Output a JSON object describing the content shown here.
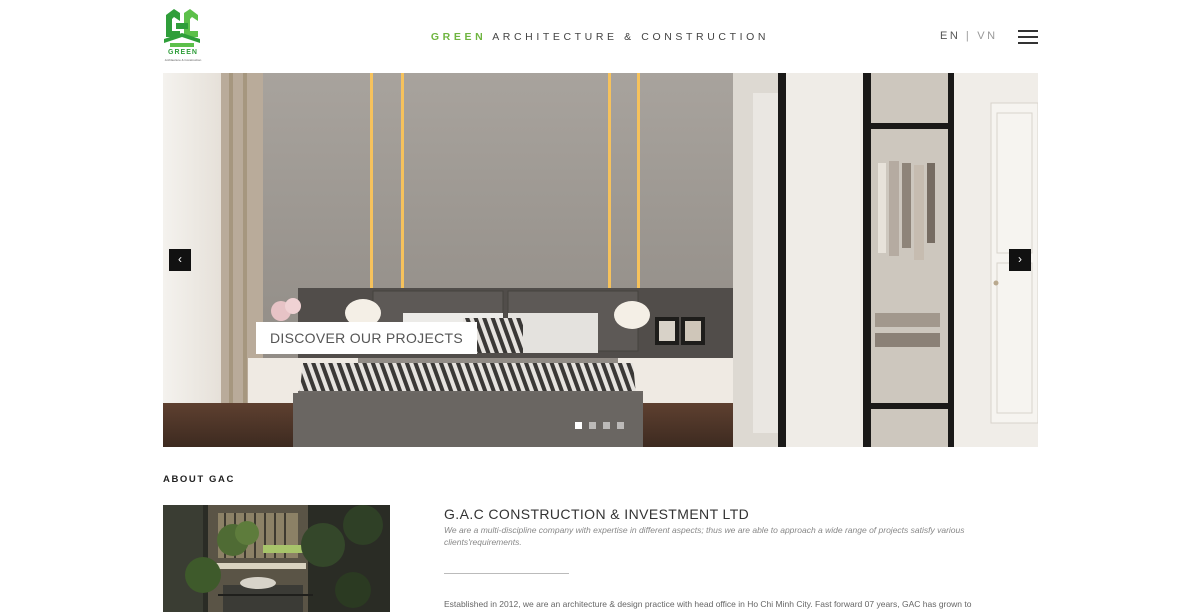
{
  "header": {
    "logo": {
      "word": "GREEN",
      "subtitle": "Architecture & Construction"
    },
    "title": {
      "highlight": "GREEN",
      "rest": "ARCHITECTURE & CONSTRUCTION"
    },
    "language": {
      "active": "EN",
      "separator": "|",
      "inactive": "VN"
    },
    "menu_icon": "hamburger-icon"
  },
  "slider": {
    "prev_icon": "‹",
    "next_icon": "›",
    "cta_label": "DISCOVER OUR PROJECTS",
    "slide_count": 4,
    "active_slide": 1
  },
  "about": {
    "heading": "ABOUT GAC",
    "company_name": "G.A.C CONSTRUCTION & INVESTMENT LTD",
    "tagline": "We are a multi-discipline company with expertise in different aspects; thus we are able to approach a wide range of projects satisfy various clients'requirements.",
    "body": "Established in 2012, we are an architecture & design practice with head office in Ho Chi Minh City. Fast forward 07 years, GAC has grown to"
  },
  "colors": {
    "brand_green": "#6fb540",
    "logo_green": "#2f9e3a",
    "text_dark": "#333333",
    "text_muted": "#888888",
    "arrow_bg": "#111111"
  }
}
